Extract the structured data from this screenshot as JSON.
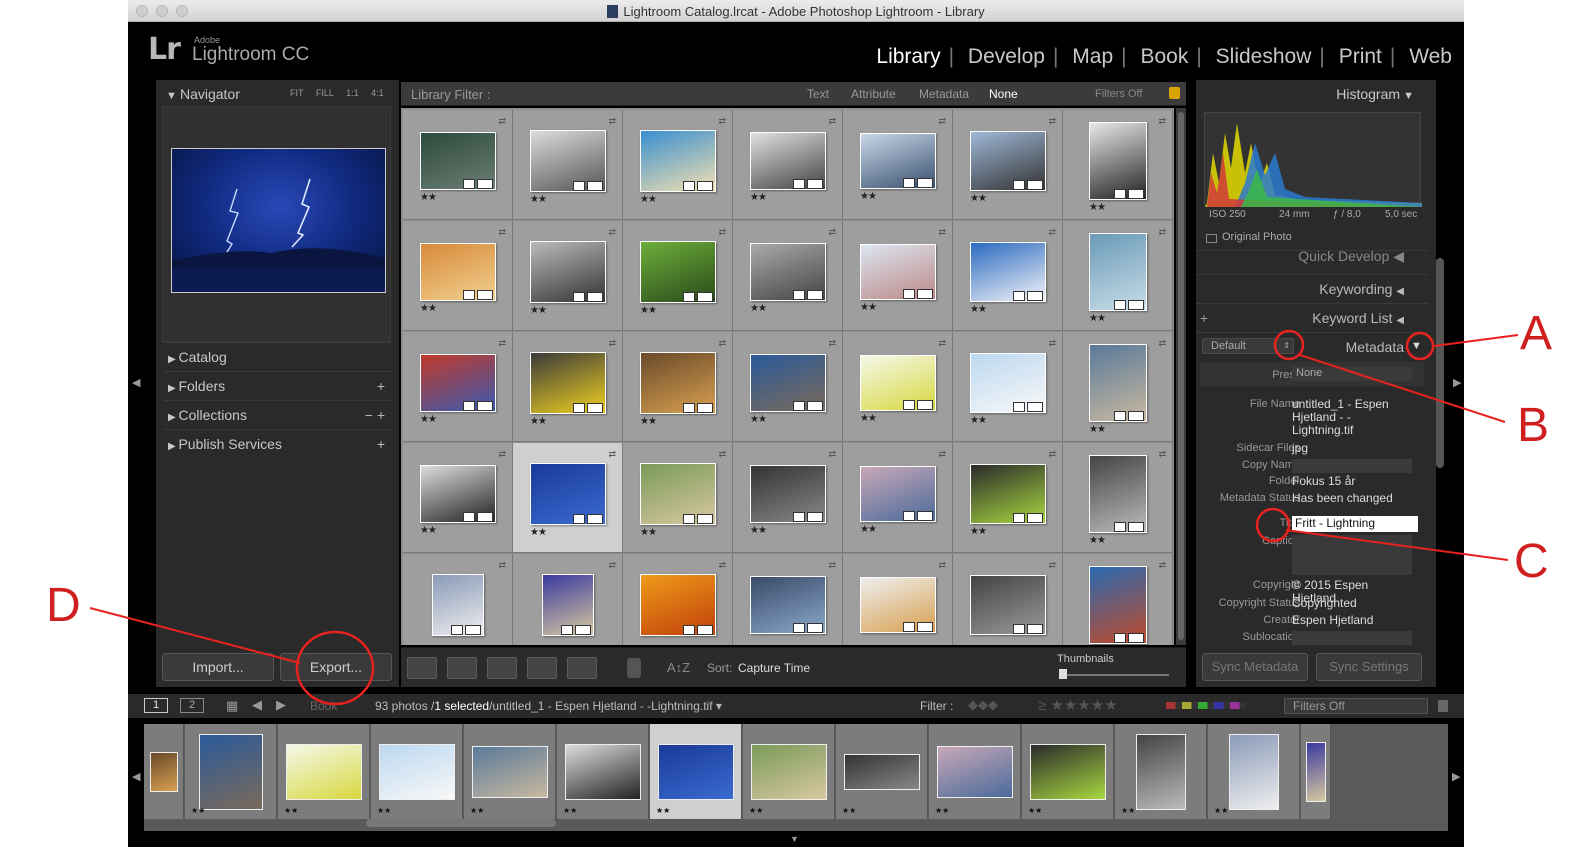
{
  "window": {
    "title": "Lightroom Catalog.lrcat - Adobe Photoshop Lightroom - Library"
  },
  "brand": {
    "logo": "Lr",
    "adobe": "Adobe",
    "name": "Lightroom CC"
  },
  "modules": [
    "Library",
    "Develop",
    "Map",
    "Book",
    "Slideshow",
    "Print",
    "Web"
  ],
  "navigator": {
    "title": "Navigator",
    "zoom": [
      "FIT",
      "FILL",
      "1:1",
      "4:1"
    ]
  },
  "left_sections": [
    {
      "label": "Catalog",
      "extra": ""
    },
    {
      "label": "Folders",
      "extra": "+"
    },
    {
      "label": "Collections",
      "extra": "−  +"
    },
    {
      "label": "Publish Services",
      "extra": "+"
    }
  ],
  "buttons": {
    "import": "Import...",
    "export": "Export..."
  },
  "filterbar": {
    "label": "Library Filter :",
    "options": [
      "Text",
      "Attribute",
      "Metadata",
      "None"
    ],
    "status": "Filters Off"
  },
  "toolbar": {
    "sort_label": "Sort:",
    "sort_value": "Capture Time",
    "thumbnails_label": "Thumbnails"
  },
  "histogram": {
    "title": "Histogram",
    "iso": "ISO 250",
    "focal": "24 mm",
    "aperture": "ƒ / 8,0",
    "shutter": "5,0 sec",
    "original": "Original Photo"
  },
  "right_sections": {
    "quick_develop": "Quick Develop",
    "keywording": "Keywording",
    "keyword_list": "Keyword List",
    "metadata": "Metadata",
    "default": "Default",
    "sync_metadata": "Sync Metadata",
    "sync_settings": "Sync Settings"
  },
  "metadata": {
    "preset_label": "Preset",
    "preset_value": "None",
    "file_name_label": "File Name",
    "file_name": "untitled_1 - Espen Hjetland - - Lightning.tif",
    "sidecar_label": "Sidecar Files",
    "sidecar": "jpg",
    "copy_name_label": "Copy Name",
    "folder_label": "Folder",
    "folder": "Fokus 15 år",
    "status_label": "Metadata Status",
    "status": "Has been changed",
    "title_label": "Title",
    "title": "Fritt - Lightning",
    "caption_label": "Caption",
    "copyright_label": "Copyright",
    "copyright": "© 2015 Espen Hjetland",
    "copyright_status_label": "Copyright Status",
    "copyright_status": "Copyrighted",
    "creator_label": "Creator",
    "creator": "Espen Hjetland",
    "sublocation_label": "Sublocation"
  },
  "filmstrip": {
    "page1": "1",
    "page2": "2",
    "source_prefix": "Book",
    "count": "93 photos /",
    "selected": "1 selected",
    "file": "/untitled_1 - Espen Hjetland - -Lightning.tif",
    "filter_label": "Filter :",
    "filter_value": "Filters Off",
    "stars": "≥ ★★★★★"
  },
  "annotations": [
    "A",
    "B",
    "C",
    "D"
  ],
  "colors": {
    "annotation": "#e8231f",
    "selected_cell": "#cfcfcf"
  }
}
